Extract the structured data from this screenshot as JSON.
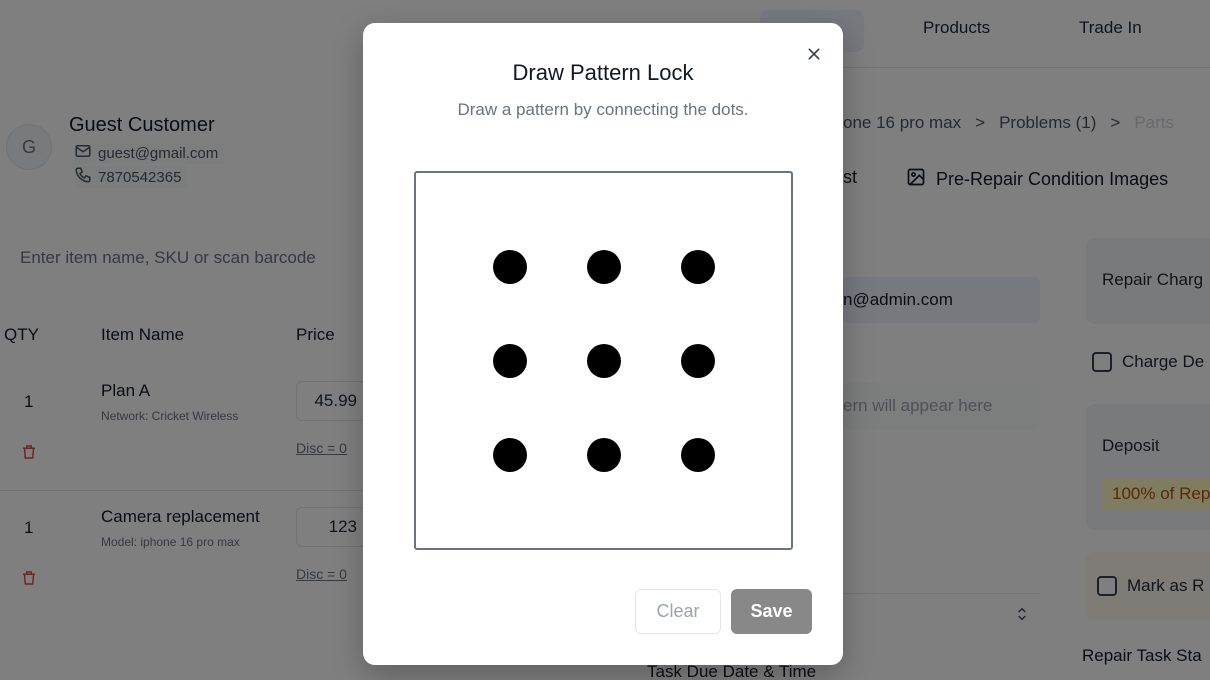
{
  "topnav": {
    "tabs": [
      "",
      "Products",
      "Trade In"
    ]
  },
  "customer": {
    "avatar_initial": "G",
    "name": "Guest Customer",
    "email": "guest@gmail.com",
    "phone": "7870542365"
  },
  "search": {
    "placeholder": "Enter item name, SKU or scan barcode"
  },
  "table": {
    "headers": {
      "qty": "QTY",
      "item": "Item Name",
      "price": "Price"
    },
    "rows": [
      {
        "qty": "1",
        "name": "Plan A",
        "sub": "Network: Cricket Wireless",
        "price": "45.99",
        "disc": "Disc = 0"
      },
      {
        "qty": "1",
        "name": "Camera replacement",
        "sub": "Model: iphone 16 pro max",
        "price": "123",
        "disc": "Disc = 0"
      }
    ]
  },
  "breadcrumbs": {
    "device": "one 16 pro max",
    "sep": ">",
    "problems": "Problems (1)",
    "parts": "Parts"
  },
  "subtabs": {
    "partial": "st",
    "images": "Pre-Repair Condition Images"
  },
  "fields": {
    "email_value": "n@admin.com",
    "pattern_placeholder": "ern will appear here"
  },
  "right_panel": {
    "repair_charge": "Repair Charg",
    "charge_deposit": "Charge De",
    "deposit": "Deposit",
    "deposit_pct": "100% of Rep",
    "mark_as": "Mark as R",
    "repair_task_status": "Repair Task Sta",
    "task_due": "Task Due Date & Time"
  },
  "modal": {
    "title": "Draw Pattern Lock",
    "subtitle": "Draw a pattern by connecting the dots.",
    "clear_label": "Clear",
    "save_label": "Save",
    "dots": 9
  },
  "colors": {
    "overlay": "#000000",
    "save_button": "#888888",
    "dot": "#000000",
    "danger": "#ef4444"
  }
}
